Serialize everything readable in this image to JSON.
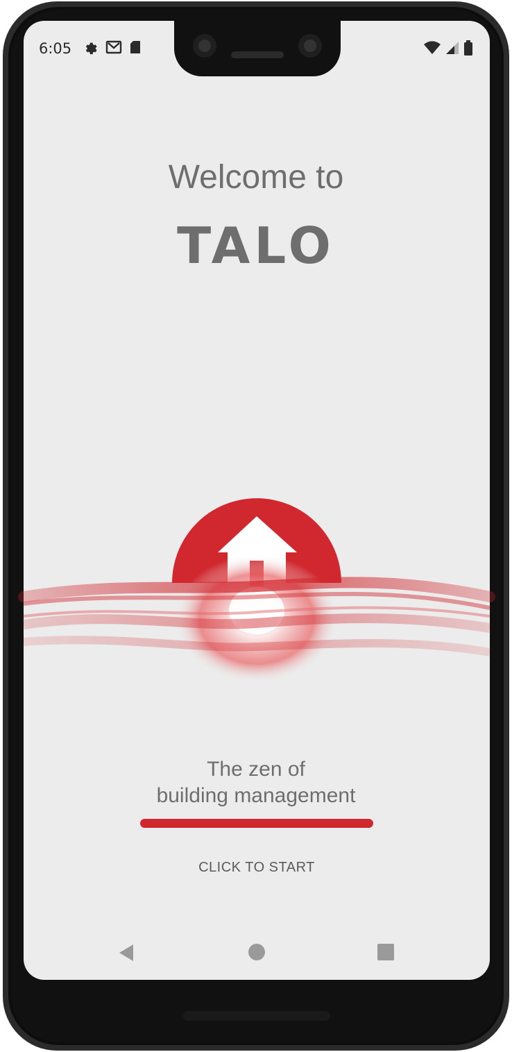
{
  "status_bar": {
    "time": "6:05",
    "left_icons": [
      "gear-icon",
      "gmail-icon",
      "sd-card-icon"
    ],
    "right_icons": [
      "wifi-icon",
      "signal-icon",
      "battery-icon"
    ]
  },
  "welcome": {
    "heading": "Welcome to",
    "brand": "TALO"
  },
  "tagline": {
    "line1": "The zen of",
    "line2": "building management"
  },
  "start_button": {
    "label": "CLICK TO START"
  },
  "nav_bar": {
    "icons": [
      "back-icon",
      "home-icon",
      "recents-icon"
    ]
  },
  "colors": {
    "accent": "#d0282e",
    "screen_bg": "#ececec",
    "text": "#6e6e6e"
  }
}
